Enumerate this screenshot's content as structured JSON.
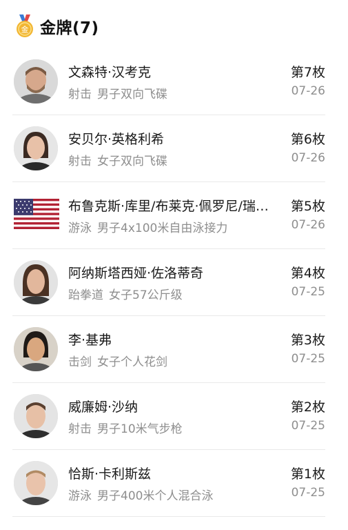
{
  "header": {
    "title": "金牌(7)",
    "medal_text": "金",
    "medal_color": "#f2b632"
  },
  "items": [
    {
      "name": "文森特·汉考克",
      "sport": "射击",
      "event": "男子双向飞碟",
      "rank": "第7枚",
      "date": "07-26",
      "avatar": "photo"
    },
    {
      "name": "安贝尔·英格利希",
      "sport": "射击",
      "event": "女子双向飞碟",
      "rank": "第6枚",
      "date": "07-26",
      "avatar": "photo"
    },
    {
      "name": "布鲁克斯·库里/布莱克·佩罗尼/瑞安·墨菲/凯莱布·德雷塞尔",
      "sport": "游泳",
      "event": "男子4x100米自由泳接力",
      "rank": "第5枚",
      "date": "07-26",
      "avatar": "us-flag"
    },
    {
      "name": "阿纳斯塔西娅·佐洛蒂奇",
      "sport": "跆拳道",
      "event": "女子57公斤级",
      "rank": "第4枚",
      "date": "07-25",
      "avatar": "photo"
    },
    {
      "name": "李·基弗",
      "sport": "击剑",
      "event": "女子个人花剑",
      "rank": "第3枚",
      "date": "07-25",
      "avatar": "photo"
    },
    {
      "name": "威廉姆·沙纳",
      "sport": "射击",
      "event": "男子10米气步枪",
      "rank": "第2枚",
      "date": "07-25",
      "avatar": "photo"
    },
    {
      "name": "恰斯·卡利斯兹",
      "sport": "游泳",
      "event": "男子400米个人混合泳",
      "rank": "第1枚",
      "date": "07-25",
      "avatar": "photo"
    }
  ],
  "colors": {
    "text_primary": "#1a1a1a",
    "text_secondary": "#8e8e8e",
    "divider": "#e9e9e9",
    "flag_red": "#b22234",
    "flag_blue": "#3c3b6e"
  }
}
